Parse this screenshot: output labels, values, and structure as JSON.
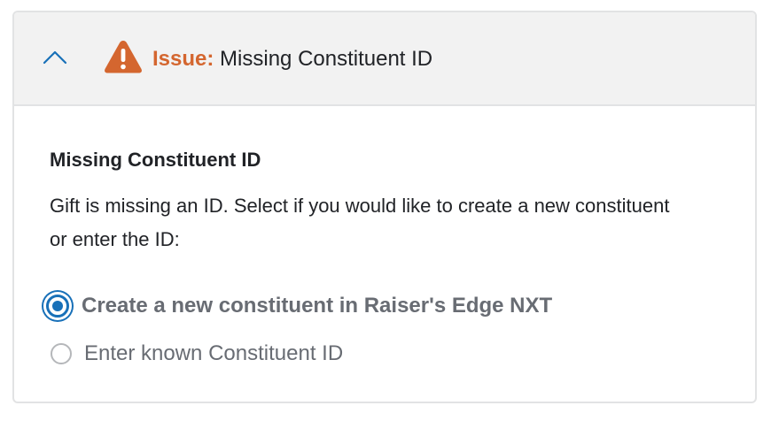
{
  "header": {
    "issue_label": "Issue:",
    "issue_text": "Missing Constituent ID",
    "collapse_icon": "chevron-up-icon",
    "warning_icon": "warning-triangle-icon"
  },
  "body": {
    "section_title": "Missing Constituent ID",
    "description": "Gift is missing an ID. Select if you would like to create a new constituent or enter the ID:",
    "options": [
      {
        "label": "Create a new constituent in Raiser's Edge NXT",
        "checked": true
      },
      {
        "label": "Enter known Constituent ID",
        "checked": false
      }
    ]
  },
  "colors": {
    "accent": "#1870b8",
    "warning": "#d4662f",
    "header_bg": "#f2f2f2",
    "border": "#e2e3e4"
  }
}
